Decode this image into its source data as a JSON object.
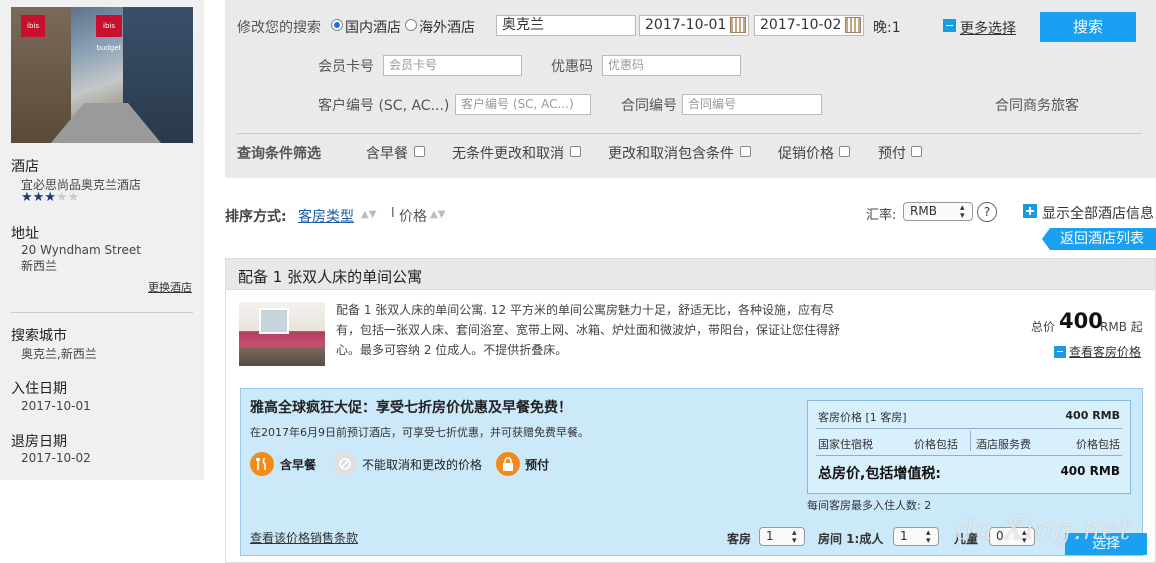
{
  "sidebar": {
    "photo_sign": "ibis budget",
    "photo_sign2": "ibis",
    "hotel_label": "酒店",
    "hotel_name": "宜必思尚品奥克兰酒店",
    "stars_on": 3,
    "stars_total": 5,
    "address_label": "地址",
    "address_line1": "20 Wyndham Street",
    "address_line2": "新西兰",
    "change_hotel": "更换酒店",
    "city_label": "搜索城市",
    "city_value": "奥克兰,新西兰",
    "checkin_label": "入住日期",
    "checkin_value": "2017-10-01",
    "checkout_label": "退房日期",
    "checkout_value": "2017-10-02"
  },
  "search": {
    "modify_label": "修改您的搜索",
    "domestic": "国内酒店",
    "overseas": "海外酒店",
    "city": "奥克兰",
    "checkin": "2017-10-01",
    "checkout": "2017-10-02",
    "nights": "晚:1",
    "more_options": "更多选择",
    "search_button": "搜索",
    "member_label": "会员卡号",
    "member_placeholder": "会员卡号",
    "promo_label": "优惠码",
    "promo_placeholder": "优惠码",
    "customer_label": "客户编号 (SC, AC...)",
    "customer_placeholder": "客户编号 (SC, AC...)",
    "contract_label": "合同编号",
    "contract_placeholder": "合同编号",
    "corporate_label": "合同商务旅客",
    "filter_label": "查询条件筛选",
    "filters": [
      "含早餐",
      "无条件更改和取消",
      "更改和取消包含条件",
      "促销价格",
      "预付"
    ]
  },
  "sort": {
    "label": "排序方式:",
    "by_room": "客房类型",
    "sep": "l",
    "by_price": "价格",
    "currency_label": "汇率:",
    "currency_value": "RMB",
    "help": "?",
    "show_all": "显示全部酒店信息",
    "back": "返回酒店列表"
  },
  "room": {
    "title": "配备 1 张双人床的单间公寓",
    "desc": "配备 1 张双人床的单间公寓. 12 平方米的单间公寓房魅力十足，舒适无比，各种设施，应有尽有，包括一张双人床、套间浴室、宽带上网、冰箱、炉灶面和微波炉，带阳台，保证让您住得舒心。最多可容纳 2 位成人。不提供折叠床。",
    "total_prefix": "总价",
    "total_price": "400",
    "total_suffix": "RMB 起",
    "view_prices": "查看客房价格"
  },
  "promo": {
    "title": "雅高全球疯狂大促：享受七折房价优惠及早餐免费！",
    "subtitle": "在2017年6月9日前预订酒店，可享受七折优惠，并可获赠免费早餐。",
    "badge_breakfast": "含早餐",
    "badge_noncancel": "不能取消和更改的价格",
    "badge_prepay": "预付",
    "terms_link": "查看该价格销售条款",
    "room_price_label": "客房价格 [1 客房]",
    "room_price_value": "400 RMB",
    "tax_label": "国家住宿税",
    "tax_value": "价格包括",
    "service_label": "酒店服务费",
    "service_value": "价格包括",
    "total_label": "总房价,包括增值税:",
    "total_value": "400 RMB",
    "max_guests": "每间客房最多入住人数: 2",
    "rooms_label": "客房",
    "rooms_value": "1",
    "adults_label": "房间 1:成人",
    "adults_value": "1",
    "children_label": "儿童",
    "children_value": "0",
    "select_button": "选择"
  },
  "watermark": "du Xing.net"
}
